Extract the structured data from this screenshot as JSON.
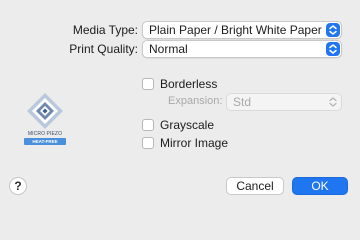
{
  "media_type": {
    "label": "Media Type:",
    "value": "Plain Paper / Bright White Paper"
  },
  "print_quality": {
    "label": "Print Quality:",
    "value": "Normal"
  },
  "borderless": {
    "label": "Borderless",
    "checked": false
  },
  "expansion": {
    "label": "Expansion:",
    "value": "Std",
    "enabled": false
  },
  "grayscale": {
    "label": "Grayscale",
    "checked": false
  },
  "mirror_image": {
    "label": "Mirror Image",
    "checked": false
  },
  "logo": {
    "text": "MICRO PIEZO",
    "badge": "HEAT-FREE"
  },
  "help": {
    "label": "?"
  },
  "buttons": {
    "cancel": "Cancel",
    "ok": "OK"
  },
  "colors": {
    "accent": "#1f76f0",
    "background": "#ececec"
  }
}
